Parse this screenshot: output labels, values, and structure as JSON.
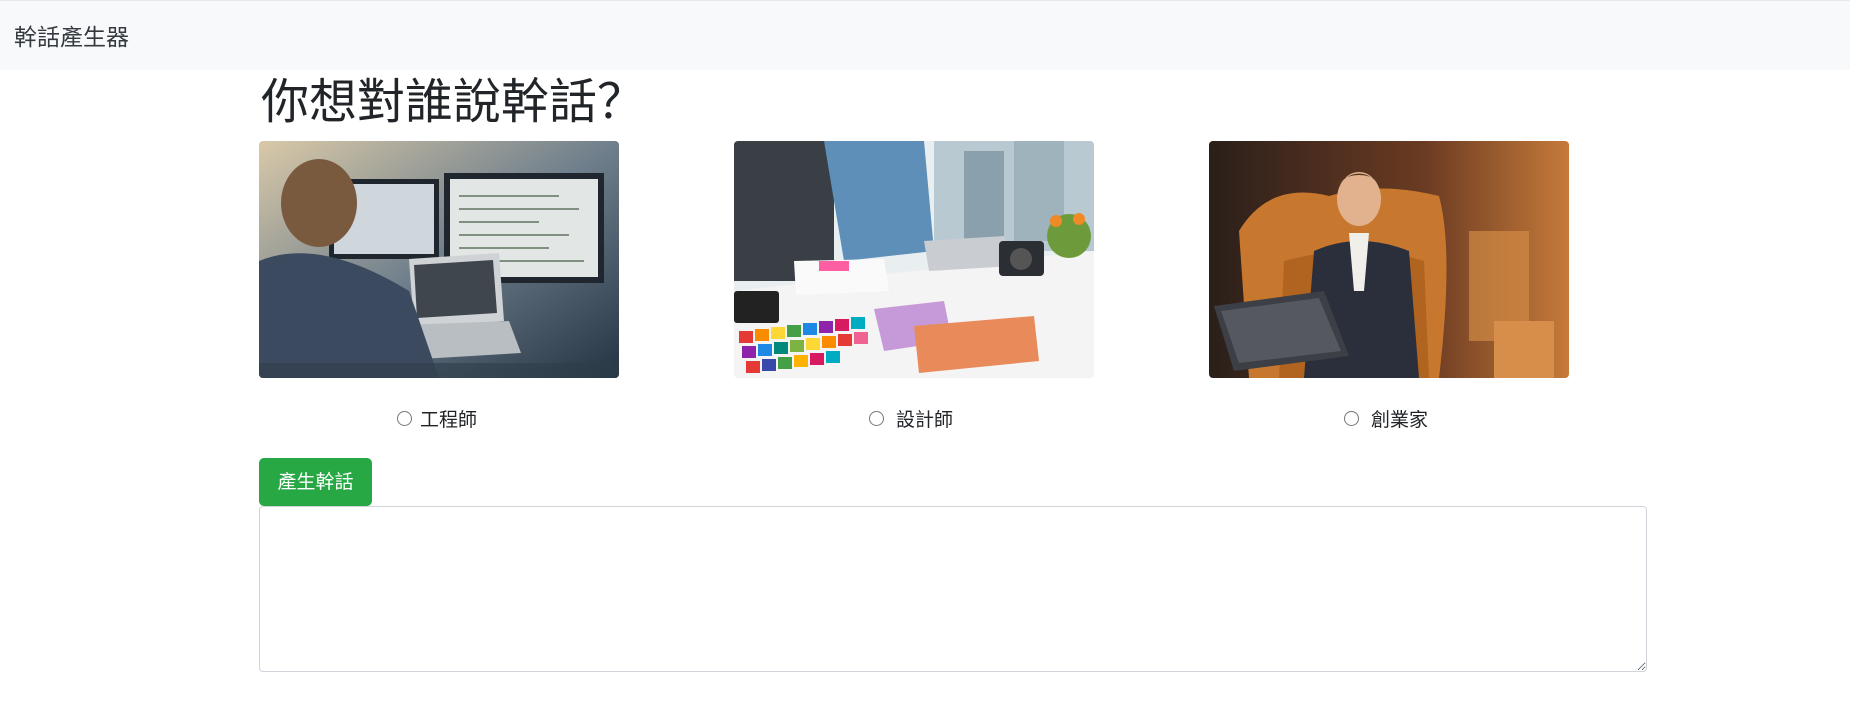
{
  "navbar": {
    "brand": "幹話產生器"
  },
  "main": {
    "heading": "你想對誰說幹話？",
    "options": [
      {
        "label": "工程師",
        "image": "engineer-photo",
        "selected": false
      },
      {
        "label": "設計師",
        "image": "designer-photo",
        "selected": false
      },
      {
        "label": "創業家",
        "image": "entrepreneur-photo",
        "selected": false
      }
    ],
    "generate_button": "產生幹話",
    "output": {
      "value": "",
      "placeholder": ""
    }
  },
  "colors": {
    "navbar_bg": "#f8f9fa",
    "button_bg": "#28a745",
    "text": "#212529"
  }
}
